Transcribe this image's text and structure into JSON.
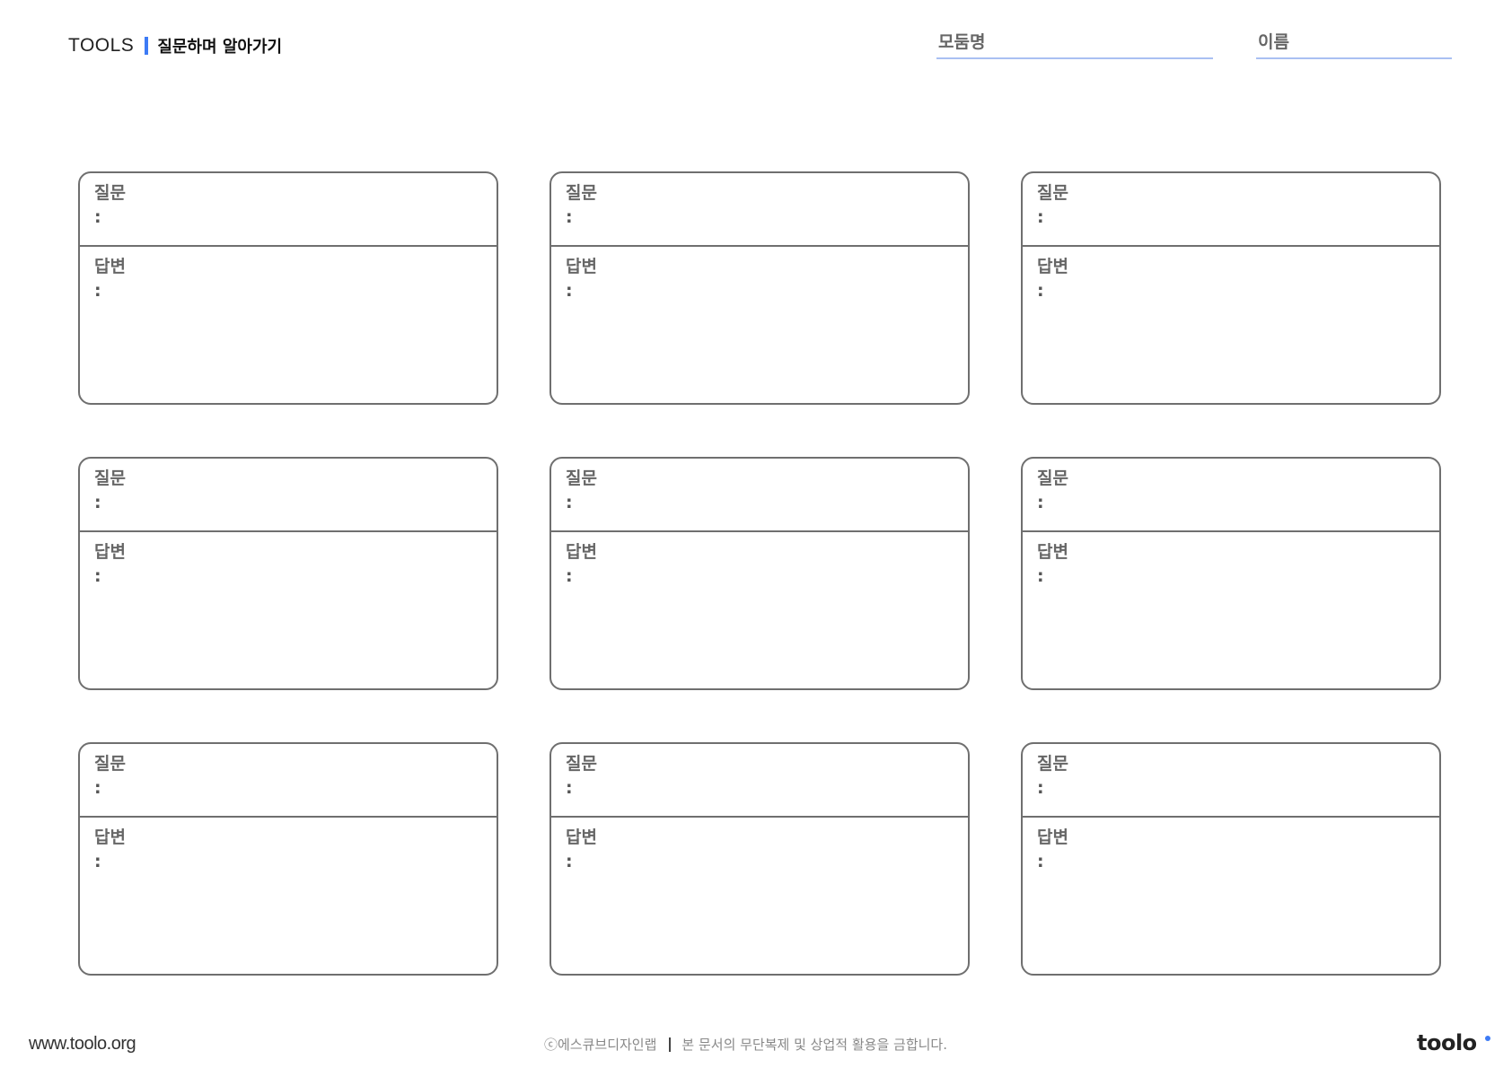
{
  "header": {
    "brand": "TOOLS",
    "title": "질문하며 알아가기",
    "accent_color": "#3d7bf5",
    "field_group_label": "모둠명",
    "field_name_label": "이름"
  },
  "cards": {
    "question_label": "질문",
    "answer_label": "답변",
    "colon": ":"
  },
  "footer": {
    "url": "www.toolo.org",
    "copyright": "ⓒ에스큐브디자인랩",
    "notice": "본 문서의 무단복제 및 상업적 활용을 금합니다.",
    "logo": "toolo"
  }
}
